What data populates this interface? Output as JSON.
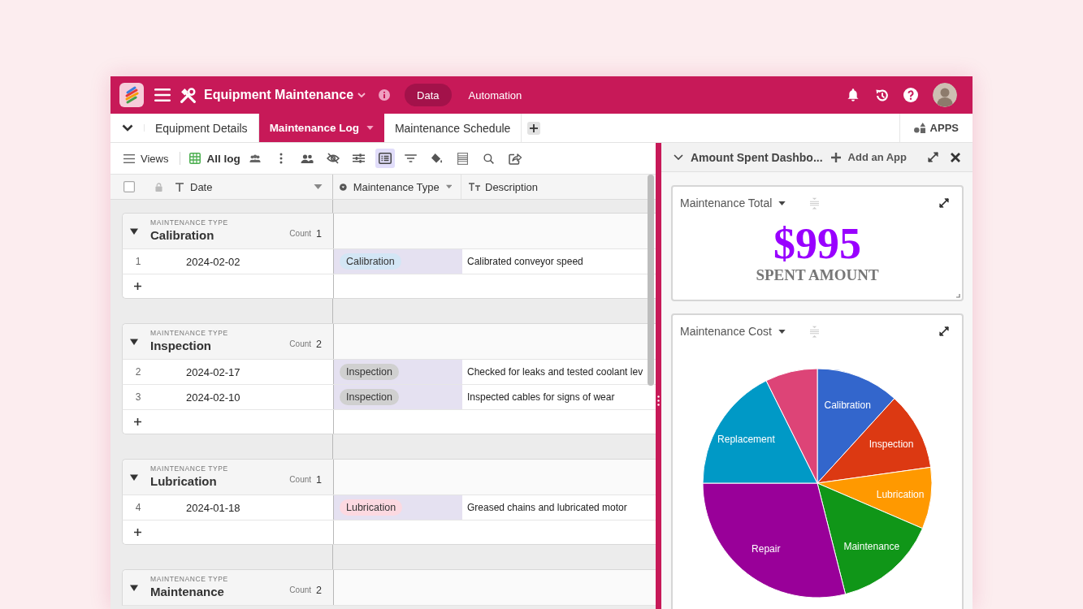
{
  "header": {
    "title": "Equipment Maintenance",
    "nav": [
      {
        "label": "Data",
        "selected": true
      },
      {
        "label": "Automation",
        "selected": false
      }
    ]
  },
  "tabs": [
    {
      "label": "Equipment Details",
      "selected": false
    },
    {
      "label": "Maintenance Log",
      "selected": true
    },
    {
      "label": "Maintenance Schedule",
      "selected": false
    }
  ],
  "apps_label": "APPS",
  "toolbar": {
    "views_label": "Views",
    "view_name": "All log",
    "tools": [
      {
        "selected": false
      },
      {
        "selected": false
      },
      {
        "selected": false
      },
      {
        "selected": false
      },
      {
        "selected": false
      },
      {
        "selected": true
      },
      {
        "selected": false
      },
      {
        "selected": false
      },
      {
        "selected": false
      },
      {
        "selected": false
      },
      {
        "selected": false
      }
    ]
  },
  "grid": {
    "select_all_checked": false,
    "columns": [
      {
        "label": "Date"
      },
      {
        "label": "Maintenance Type"
      },
      {
        "label": "Description"
      }
    ],
    "groups": [
      {
        "field_label": "MAINTENANCE TYPE",
        "name": "Calibration",
        "count_label": "Count",
        "count": "1",
        "expanded": true,
        "rows": [
          {
            "number": "1",
            "date": "2024-02-02",
            "type": {
              "label": "Calibration",
              "color": "#d3e6f5"
            },
            "description": "Calibrated conveyor speed"
          }
        ]
      },
      {
        "field_label": "MAINTENANCE TYPE",
        "name": "Inspection",
        "count_label": "Count",
        "count": "2",
        "expanded": true,
        "rows": [
          {
            "number": "2",
            "date": "2024-02-17",
            "type": {
              "label": "Inspection",
              "color": "#d0d0d0"
            },
            "description": "Checked for leaks and tested coolant lev"
          },
          {
            "number": "3",
            "date": "2024-02-10",
            "type": {
              "label": "Inspection",
              "color": "#d0d0d0"
            },
            "description": "Inspected cables for signs of wear"
          }
        ]
      },
      {
        "field_label": "MAINTENANCE TYPE",
        "name": "Lubrication",
        "count_label": "Count",
        "count": "1",
        "expanded": true,
        "rows": [
          {
            "number": "4",
            "date": "2024-01-18",
            "type": {
              "label": "Lubrication",
              "color": "#fcd9e1"
            },
            "description": "Greased chains and lubricated motor"
          }
        ]
      },
      {
        "field_label": "MAINTENANCE TYPE",
        "name": "Maintenance",
        "count_label": "Count",
        "count": "2",
        "expanded": true
      }
    ]
  },
  "panel": {
    "title": "Amount Spent Dashbo...",
    "add_label": "Add an App",
    "widgets": [
      {
        "kind": "number",
        "title": "Maintenance Total",
        "value": "$995",
        "caption": "SPENT AMOUNT"
      },
      {
        "kind": "pie",
        "title": "Maintenance Cost",
        "slices": [
          {
            "label": "Calibration",
            "color": "#3366cc"
          },
          {
            "label": "Inspection",
            "color": "#dc3912"
          },
          {
            "label": "Lubrication",
            "color": "#ff9900"
          },
          {
            "label": "Maintenance",
            "color": "#109618"
          },
          {
            "label": "Repair",
            "color": "#990099"
          },
          {
            "label": "Replacement",
            "color": "#0099c6"
          },
          {
            "color": "#dd4477"
          }
        ]
      }
    ]
  }
}
